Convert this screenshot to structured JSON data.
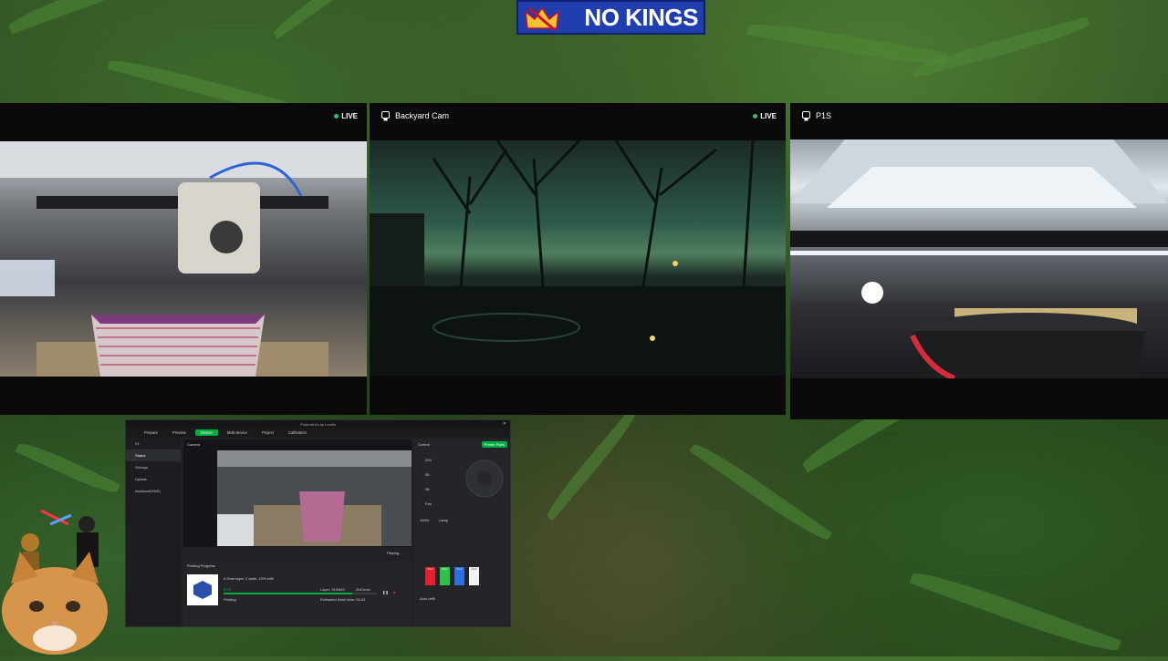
{
  "banner": {
    "text": "NO KINGS"
  },
  "cameras": [
    {
      "title": "",
      "live_label": "LIVE"
    },
    {
      "title": "Backyard Cam",
      "live_label": "LIVE"
    },
    {
      "title": "P1S",
      "live_label": ""
    }
  ],
  "app": {
    "title": "Polaroid-bo.hp Lentils",
    "tabs": [
      "Prepare",
      "Preview",
      "Device",
      "Multi-device",
      "Project",
      "Calibration"
    ],
    "active_tab": "Device",
    "printer": "X1",
    "sidebar": [
      "Status",
      "Storage",
      "Update",
      "Assistant(HMS)"
    ],
    "camera_label": "Camera",
    "playing_label": "Playing...",
    "control_label": "Control",
    "printer_parts_button": "Printer Parts",
    "temps": [
      "220",
      "55",
      "38"
    ],
    "fan_label": "Fan",
    "fan_speed": "100%",
    "lamp_label": "Lamp",
    "printing_progress_label": "Printing Progress",
    "job_name": "0.2mm layer, 2 walls, 10% infill",
    "percent": "84%",
    "status": "Printing",
    "layer": "Layer: 313/543",
    "remaining": "-2h21min",
    "eta": "Estimated finish time: 04:23",
    "progress": 0.84,
    "ams_slots": [
      {
        "label": "PLA",
        "color": "#e5202e"
      },
      {
        "label": "PLA",
        "color": "#2fc24a"
      },
      {
        "label": "PLA",
        "color": "#2b6fe0"
      },
      {
        "label": "PLA",
        "color": "#f2f2f2"
      }
    ],
    "auto_refill": "Auto-refill"
  }
}
